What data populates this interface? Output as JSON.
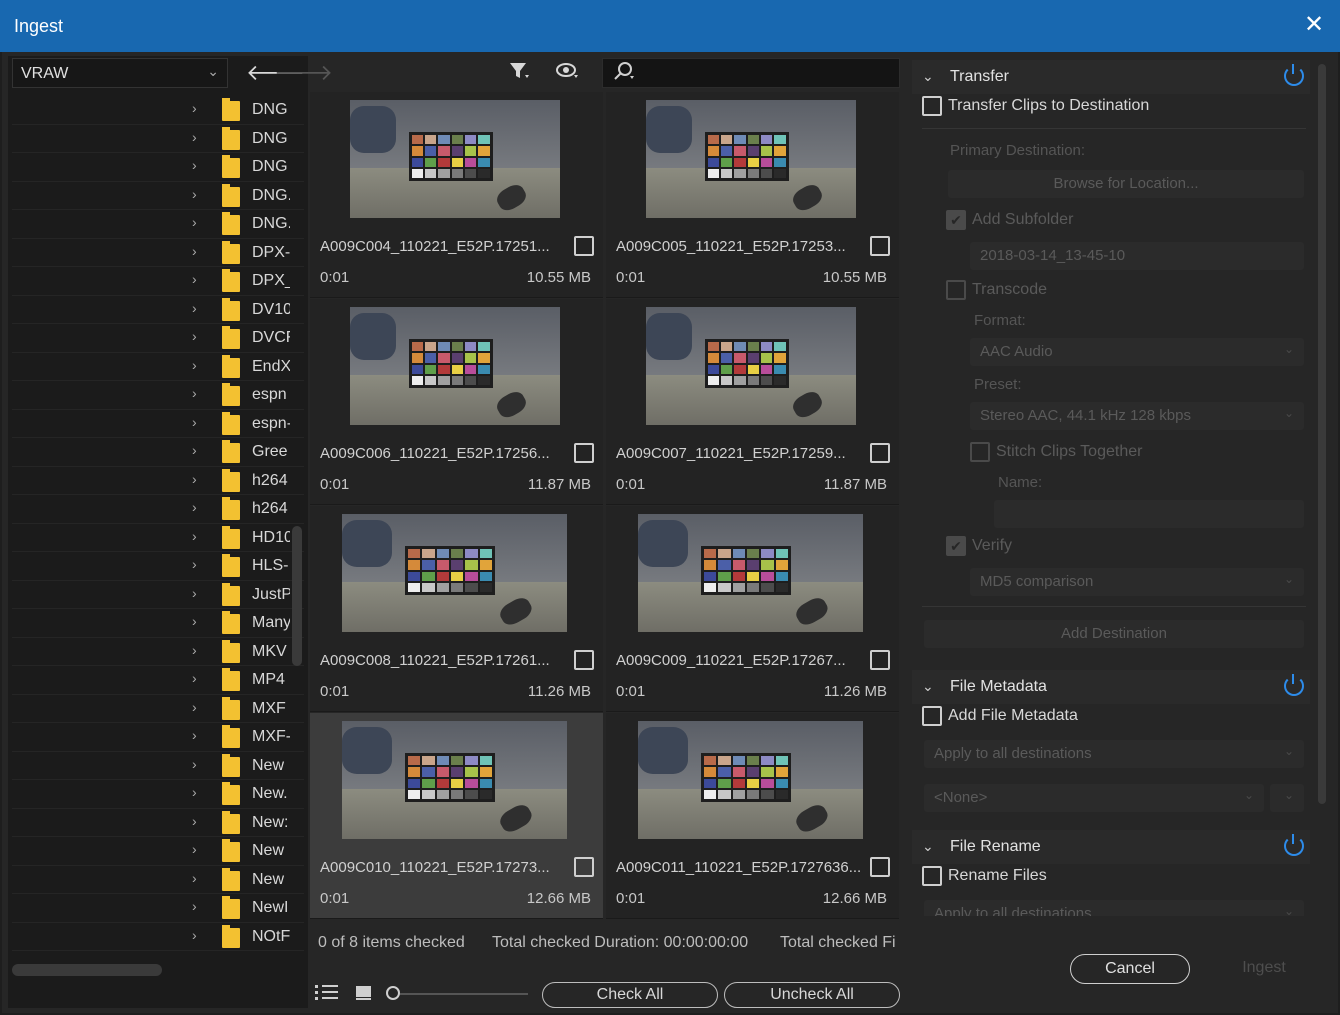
{
  "window": {
    "title": "Ingest",
    "close_label": "✕"
  },
  "left_panel": {
    "location": "VRAW",
    "back_icon": "arrow-left-icon",
    "forward_icon": "arrow-right-icon",
    "folders": [
      "DNG",
      "DNG",
      "DNG",
      "DNG.",
      "DNG.",
      "DPX-",
      "DPX_",
      "DV10",
      "DVCF",
      "EndX",
      "espn",
      "espn-",
      "Gree",
      "h264",
      "h264",
      "HD10",
      "HLS-",
      "JustP",
      "Many",
      "MKV",
      "MP4",
      "MXF",
      "MXF-",
      "New",
      "New.",
      "New:",
      "New",
      "New",
      "NewI",
      "NOtF"
    ]
  },
  "toolbar": {
    "filter_icon": "filter-icon",
    "preview_icon": "eye-icon",
    "search_placeholder": "",
    "search_icon": "search-icon"
  },
  "clips": [
    {
      "name": "A009C004_110221_E52P.17251...",
      "duration": "0:01",
      "size": "10.55 MB",
      "selected": false
    },
    {
      "name": "A009C005_110221_E52P.17253...",
      "duration": "0:01",
      "size": "10.55 MB",
      "selected": false
    },
    {
      "name": "A009C006_110221_E52P.17256...",
      "duration": "0:01",
      "size": "11.87 MB",
      "selected": false
    },
    {
      "name": "A009C007_110221_E52P.17259...",
      "duration": "0:01",
      "size": "11.87 MB",
      "selected": false
    },
    {
      "name": "A009C008_110221_E52P.17261...",
      "duration": "0:01",
      "size": "11.26 MB",
      "selected": false
    },
    {
      "name": "A009C009_110221_E52P.17267...",
      "duration": "0:01",
      "size": "11.26 MB",
      "selected": false
    },
    {
      "name": "A009C010_110221_E52P.17273...",
      "duration": "0:01",
      "size": "12.66 MB",
      "selected": true
    },
    {
      "name": "A009C011_110221_E52P.1727636...",
      "duration": "0:01",
      "size": "12.66 MB",
      "selected": false
    }
  ],
  "status": {
    "checked": "0 of 8 items checked",
    "duration": "Total checked Duration: 00:00:00:00",
    "files": "Total checked Fi"
  },
  "bottom": {
    "list_view_icon": "list-view-icon",
    "thumb_view_icon": "thumbnail-view-icon",
    "check_all": "Check All",
    "uncheck_all": "Uncheck All"
  },
  "transfer": {
    "header": "Transfer",
    "transfer_clips": "Transfer Clips to Destination",
    "primary_destination": "Primary Destination:",
    "browse": "Browse for Location...",
    "add_subfolder": "Add Subfolder",
    "subfolder_value": "2018-03-14_13-45-10",
    "transcode": "Transcode",
    "format_label": "Format:",
    "format_value": "AAC Audio",
    "preset_label": "Preset:",
    "preset_value": "Stereo AAC, 44.1 kHz 128 kbps",
    "stitch": "Stitch Clips Together",
    "name_label": "Name:",
    "verify": "Verify",
    "verify_value": "MD5 comparison",
    "add_destination": "Add Destination"
  },
  "file_metadata": {
    "header": "File Metadata",
    "add_metadata": "Add File Metadata",
    "apply_all": "Apply to all destinations",
    "none_value": "<None>"
  },
  "file_rename": {
    "header": "File Rename",
    "rename_files": "Rename Files",
    "apply_all": "Apply to all destinations"
  },
  "actions": {
    "cancel": "Cancel",
    "ingest": "Ingest"
  },
  "colors": {
    "titlebar": "#1868b0",
    "accent": "#2d8ceb",
    "folder": "#f3c131"
  }
}
